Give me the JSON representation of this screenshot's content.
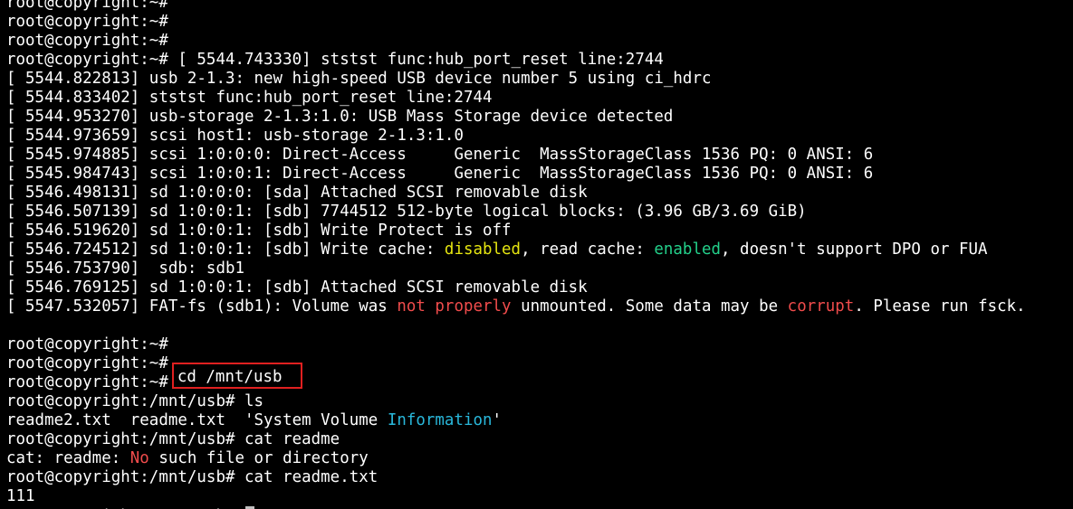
{
  "colors": {
    "background": "#000000",
    "text": "#ffffff",
    "yellow": "#e5e510",
    "green": "#23d18b",
    "red": "#f14c4c",
    "cyan": "#29b8db",
    "highlight_box": "#e02020",
    "cursor": "#c0c0c0"
  },
  "terminal": {
    "lines": [
      {
        "segments": [
          {
            "text": "root@copyright:~#"
          }
        ]
      },
      {
        "segments": [
          {
            "text": "root@copyright:~#"
          }
        ]
      },
      {
        "segments": [
          {
            "text": "root@copyright:~#"
          }
        ]
      },
      {
        "segments": [
          {
            "text": "root@copyright:~# [ 5544.743330] ststst func:hub_port_reset line:2744"
          }
        ]
      },
      {
        "segments": [
          {
            "text": "[ 5544.822813] usb 2-1.3: new high-speed USB device number 5 using ci_hdrc"
          }
        ]
      },
      {
        "segments": [
          {
            "text": "[ 5544.833402] ststst func:hub_port_reset line:2744"
          }
        ]
      },
      {
        "segments": [
          {
            "text": "[ 5544.953270] usb-storage 2-1.3:1.0: USB Mass Storage device detected"
          }
        ]
      },
      {
        "segments": [
          {
            "text": "[ 5544.973659] scsi host1: usb-storage 2-1.3:1.0"
          }
        ]
      },
      {
        "segments": [
          {
            "text": "[ 5545.974885] scsi 1:0:0:0: Direct-Access     Generic  MassStorageClass 1536 PQ: 0 ANSI: 6"
          }
        ]
      },
      {
        "segments": [
          {
            "text": "[ 5545.984743] scsi 1:0:0:1: Direct-Access     Generic  MassStorageClass 1536 PQ: 0 ANSI: 6"
          }
        ]
      },
      {
        "segments": [
          {
            "text": "[ 5546.498131] sd 1:0:0:0: [sda] Attached SCSI removable disk"
          }
        ]
      },
      {
        "segments": [
          {
            "text": "[ 5546.507139] sd 1:0:0:1: [sdb] 7744512 512-byte logical blocks: (3.96 GB/3.69 GiB)"
          }
        ]
      },
      {
        "segments": [
          {
            "text": "[ 5546.519620] sd 1:0:0:1: [sdb] Write Protect is off"
          }
        ]
      },
      {
        "segments": [
          {
            "text": "[ 5546.724512] sd 1:0:0:1: [sdb] Write cache: "
          },
          {
            "text": "disabled",
            "color": "yellow"
          },
          {
            "text": ", read cache: "
          },
          {
            "text": "enabled",
            "color": "green"
          },
          {
            "text": ", doesn't support DPO or FUA"
          }
        ]
      },
      {
        "segments": [
          {
            "text": "[ 5546.753790]  sdb: sdb1"
          }
        ]
      },
      {
        "segments": [
          {
            "text": "[ 5546.769125] sd 1:0:0:1: [sdb] Attached SCSI removable disk"
          }
        ]
      },
      {
        "segments": [
          {
            "text": "[ 5547.532057] FAT-fs (sdb1): Volume was "
          },
          {
            "text": "not properly",
            "color": "red"
          },
          {
            "text": " unmounted. Some data may be "
          },
          {
            "text": "corrupt",
            "color": "red"
          },
          {
            "text": ". Please run fsck."
          }
        ]
      },
      {
        "segments": [
          {
            "text": ""
          }
        ]
      },
      {
        "segments": [
          {
            "text": "root@copyright:~#"
          }
        ]
      },
      {
        "segments": [
          {
            "text": "root@copyright:~#"
          }
        ]
      },
      {
        "segments": [
          {
            "text": "root@copyright:~#"
          },
          {
            "text": "cd /mnt/usb",
            "boxed": true
          }
        ]
      },
      {
        "segments": [
          {
            "text": "root@copyright:/mnt/usb# ls"
          }
        ]
      },
      {
        "segments": [
          {
            "text": "readme2.txt  readme.txt  'System Volume "
          },
          {
            "text": "Information",
            "color": "cyan"
          },
          {
            "text": "'"
          }
        ]
      },
      {
        "segments": [
          {
            "text": "root@copyright:/mnt/usb# cat readme"
          }
        ]
      },
      {
        "segments": [
          {
            "text": "cat: readme: "
          },
          {
            "text": "No",
            "color": "red"
          },
          {
            "text": " such file or directory"
          }
        ]
      },
      {
        "segments": [
          {
            "text": "root@copyright:/mnt/usb# cat readme.txt"
          }
        ]
      },
      {
        "segments": [
          {
            "text": "111"
          }
        ]
      },
      {
        "segments": [
          {
            "text": "root@copyright:/mnt/usb# "
          }
        ],
        "cursor": true
      }
    ]
  }
}
